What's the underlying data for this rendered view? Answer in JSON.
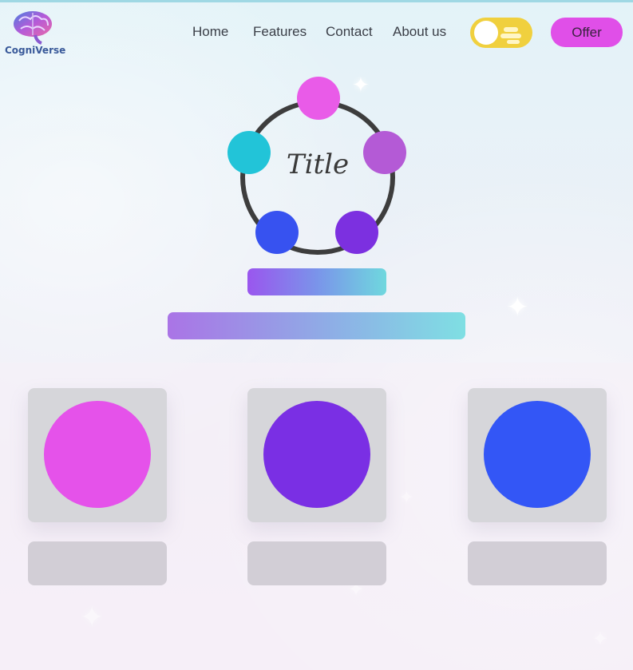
{
  "app": {
    "name": "CogniVerse",
    "logo_icon": "brain-icon"
  },
  "nav": {
    "links": [
      "Home",
      "Features",
      "Contact",
      "About us"
    ],
    "theme_toggle": {
      "state": "light",
      "icons": [
        "sun-icon",
        "cloud-icon"
      ]
    },
    "cta_label": "Offer"
  },
  "hero": {
    "title": "Title",
    "orbit_nodes": [
      "#e95be8",
      "#b45ad6",
      "#7c30e0",
      "#3752f0",
      "#22c4d8"
    ]
  },
  "features": {
    "cards": [
      {
        "color": "#e552ea"
      },
      {
        "color": "#7a2fe4"
      },
      {
        "color": "#3356f6"
      }
    ]
  },
  "colors": {
    "accent": "#e04fe8",
    "toggle": "#f0d03e",
    "text": "#3a3e47",
    "ring": "#3d3d3d"
  }
}
